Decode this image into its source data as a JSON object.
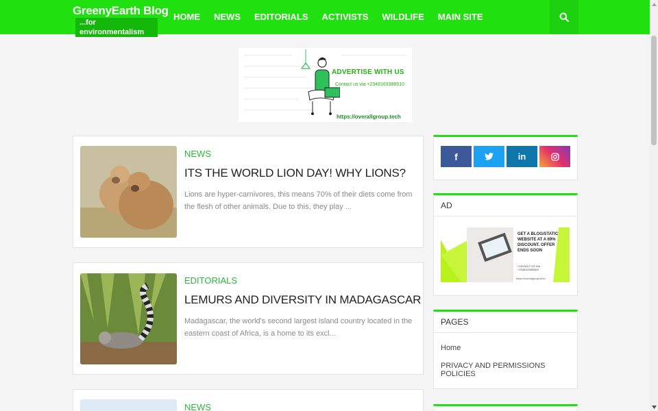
{
  "header": {
    "logo_title": "GreenyEarth Blog",
    "logo_subtitle": "...for environmentalism",
    "nav": [
      "HOME",
      "NEWS",
      "EDITORIALS",
      "ACTIVISTS",
      "WILDLIFE",
      "MAIN SITE"
    ],
    "search_icon": "search-icon"
  },
  "ad_banner": {
    "headline": "ADVERTISE WITH US",
    "contact": "Contact us via +2348163388510",
    "url": "https://overallgroup.tech"
  },
  "posts": [
    {
      "category": "NEWS",
      "title": "ITS THE WORLD LION DAY! WHY LIONS?",
      "snippet": "Lions are hyper-carnivores, this means 70% of their diets come from the flesh of other animals. Due to this, they play ..."
    },
    {
      "category": "EDITORIALS",
      "title": "LEMURS AND DIVERSITY IN MADAGASCAR",
      "snippet": "Madagascar, the world's second largest island country located in the eastern coast of Africa, is a home to its excl..."
    },
    {
      "category": "NEWS",
      "title": "",
      "snippet": ""
    }
  ],
  "sidebar": {
    "social": [
      {
        "icon": "facebook-icon",
        "glyph": "f",
        "color": "#3b5998"
      },
      {
        "icon": "twitter-icon",
        "glyph": "t",
        "color": "#1da1f2"
      },
      {
        "icon": "linkedin-icon",
        "glyph": "in",
        "color": "#0e76a8"
      },
      {
        "icon": "instagram-icon",
        "glyph": "ig",
        "color": "#d6249f"
      }
    ],
    "ad_title": "AD",
    "ad_text": "GET A BLOG/STATIC WEBSITE AT A 69% DISCOUNT. OFFER ENDS SOON",
    "ad_contact": "CONTACT US VIA +2348163388510",
    "ad_url": "https://overallgroup.tech",
    "pages_title": "PAGES",
    "pages": [
      "Home",
      "PRIVACY AND PERMISSIONS POLICIES"
    ]
  },
  "colors": {
    "brand_green": "#20e010",
    "category_green": "#28b83a"
  }
}
